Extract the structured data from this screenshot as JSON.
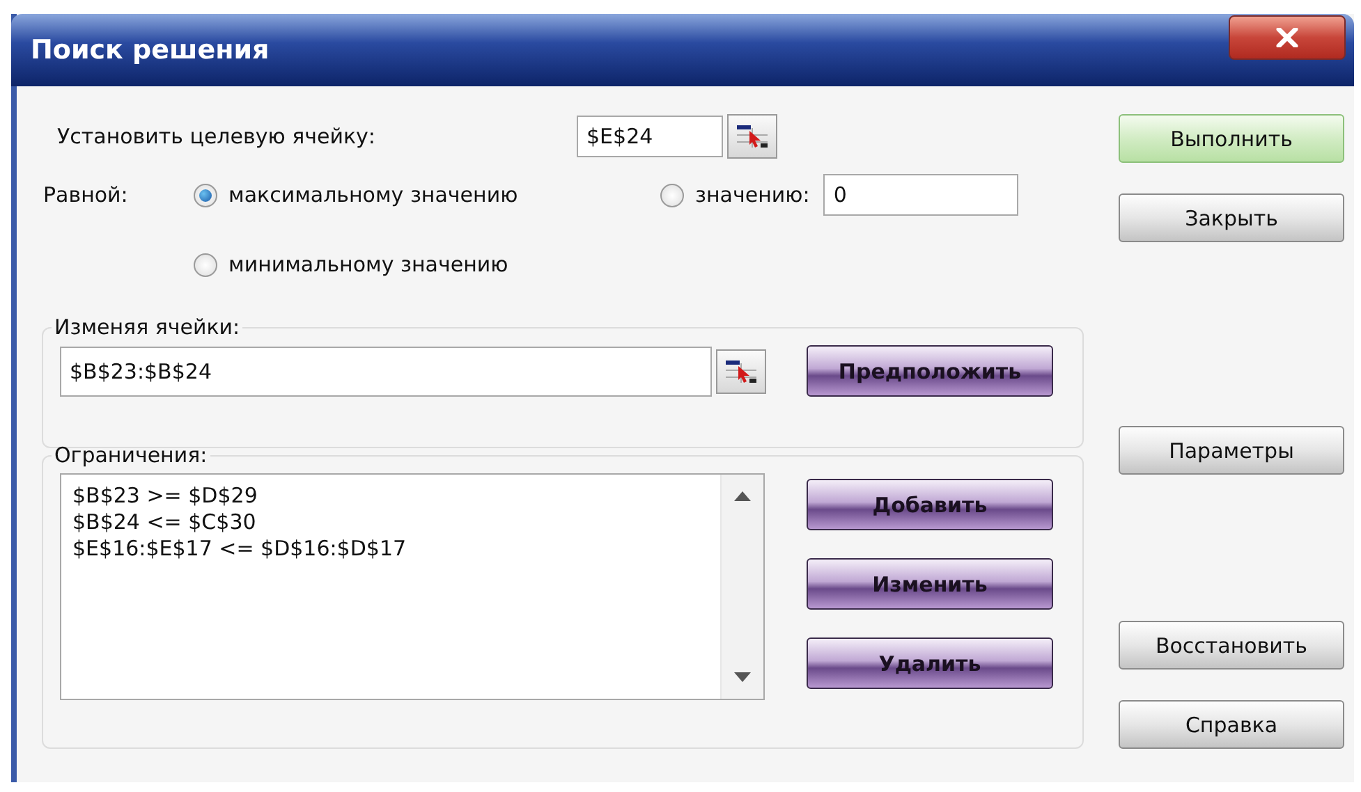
{
  "window": {
    "title": "Поиск решения"
  },
  "target_cell": {
    "label": "Установить целевую ячейку:",
    "value": "$E$24"
  },
  "equal_to": {
    "label": "Равной:",
    "value": "0",
    "options": [
      {
        "label": "максимальному значению",
        "selected": true
      },
      {
        "label": "значению:",
        "selected": false
      },
      {
        "label": "минимальному значению",
        "selected": false
      }
    ]
  },
  "changing_cells": {
    "label": "Изменяя ячейки:",
    "value": "$B$23:$B$24",
    "button": {
      "label": "Предположить",
      "kind": "purple"
    }
  },
  "constraints": {
    "label": "Ограничения:",
    "items": [
      "$B$23 >= $D$29",
      "$B$24 <= $C$30",
      "$E$16:$E$17 <= $D$16:$D$17"
    ],
    "buttons": [
      {
        "label": "Добавить",
        "kind": "purple"
      },
      {
        "label": "Изменить",
        "kind": "purple"
      },
      {
        "label": "Удалить",
        "kind": "purple"
      }
    ]
  },
  "side_buttons": [
    {
      "label": "Выполнить",
      "kind": "default"
    },
    {
      "label": "Закрыть",
      "kind": "normal"
    },
    {
      "label": "Параметры",
      "kind": "normal"
    },
    {
      "label": "Восстановить",
      "kind": "normal"
    },
    {
      "label": "Справка",
      "kind": "normal"
    }
  ]
}
